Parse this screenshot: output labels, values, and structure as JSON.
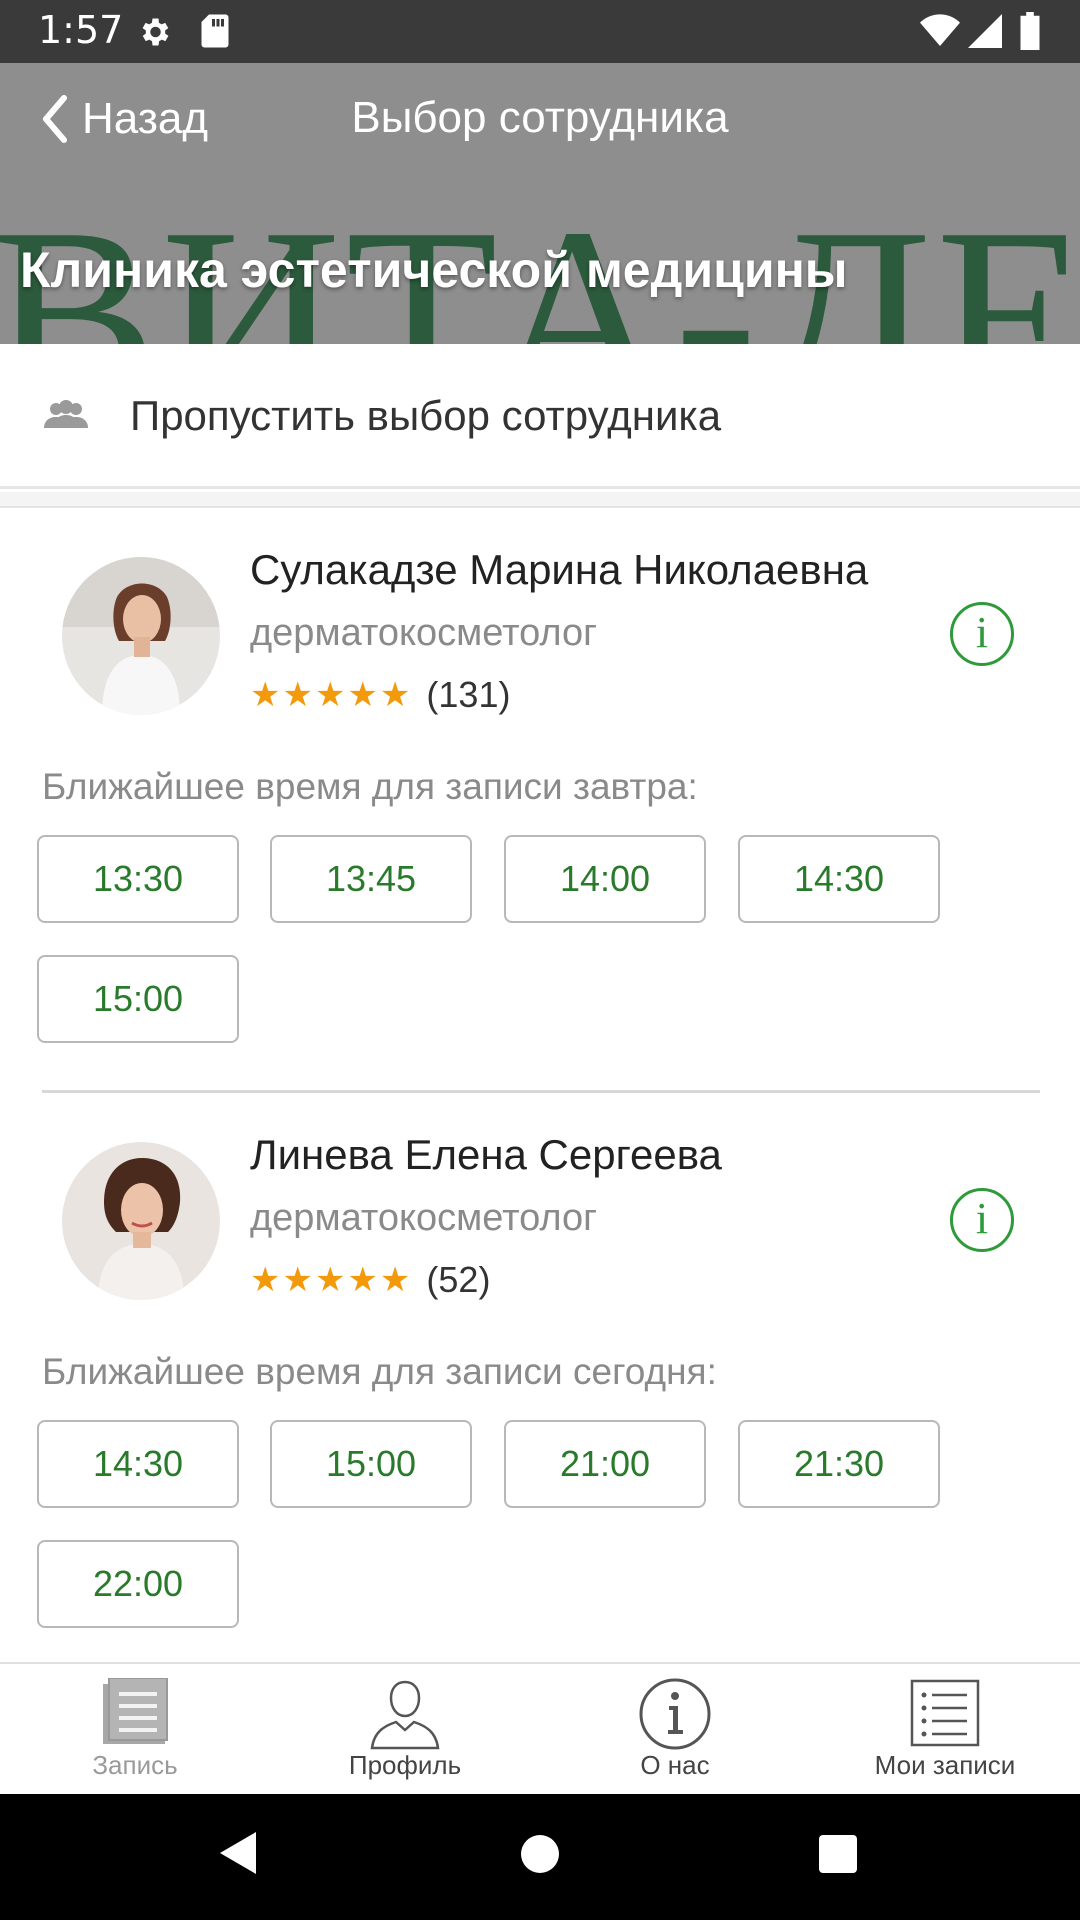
{
  "status_bar": {
    "time": "1:57"
  },
  "header": {
    "back_label": "Назад",
    "title": "Выбор сотрудника",
    "clinic_name": "Клиника эстетической медицины",
    "brand_watermark": "ВИТА-ДЕРМА"
  },
  "skip": {
    "label": "Пропустить выбор сотрудника"
  },
  "employees": [
    {
      "name": "Сулакадзе Марина Николаевна",
      "role": "дерматокосметолог",
      "stars": "★★★★★",
      "reviews": "(131)",
      "slots_label": "Ближайшее время для записи завтра:",
      "slots": [
        "13:30",
        "13:45",
        "14:00",
        "14:30",
        "15:00"
      ]
    },
    {
      "name": "Линева Елена Сергеева",
      "role": "дерматокосметолог",
      "stars": "★★★★★",
      "reviews": "(52)",
      "slots_label": "Ближайшее время для записи сегодня:",
      "slots": [
        "14:30",
        "15:00",
        "21:00",
        "21:30",
        "22:00"
      ]
    }
  ],
  "bottom_nav": {
    "items": [
      {
        "label": "Запись",
        "icon": "record-icon"
      },
      {
        "label": "Профиль",
        "icon": "profile-icon"
      },
      {
        "label": "О нас",
        "icon": "info-icon"
      },
      {
        "label": "Мои записи",
        "icon": "list-icon"
      }
    ]
  },
  "colors": {
    "accent": "#2a7a2c",
    "star": "#f39a0c",
    "header_bg": "#8e8e8e"
  }
}
